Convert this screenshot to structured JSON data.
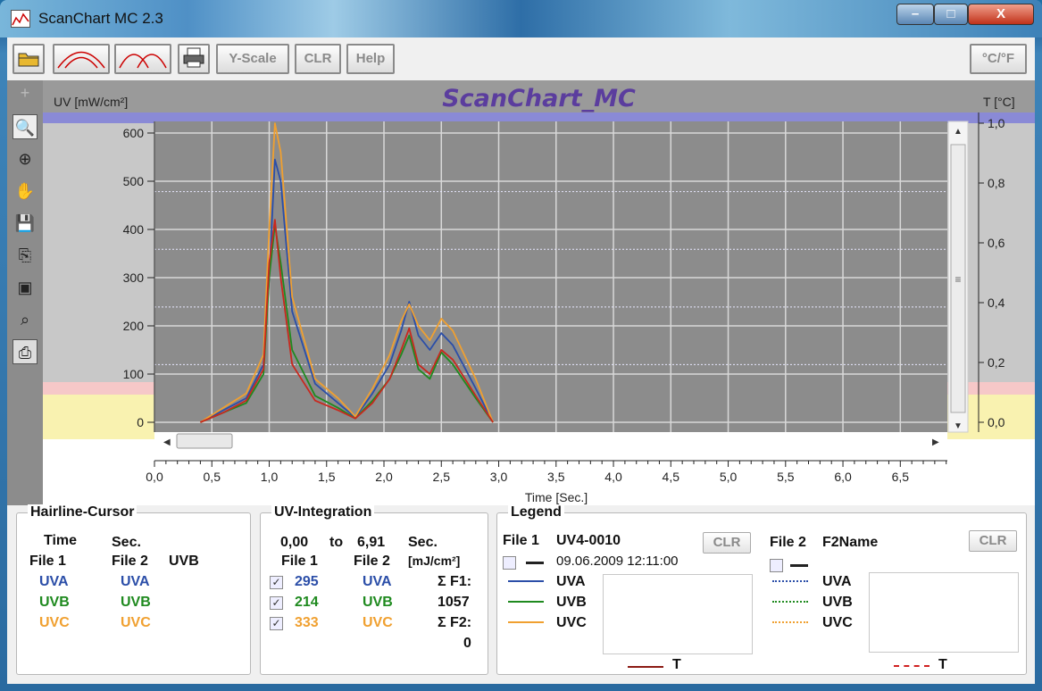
{
  "window": {
    "title": "ScanChart MC 2.3",
    "min": "–",
    "max": "□",
    "close": "X"
  },
  "toolbar": {
    "ylscale": "Y-Scale",
    "clr": "CLR",
    "help": "Help",
    "unit": "°C/°F"
  },
  "chart": {
    "title": "ScanChart_MC",
    "ylabel_left": "UV [mW/cm²]",
    "ylabel_right": "T [°C]",
    "xlabel": "Time [Sec.]",
    "ticks_left": [
      "0",
      "100",
      "200",
      "300",
      "400",
      "500",
      "600"
    ],
    "ticks_right": [
      "0,0",
      "0,2",
      "0,4",
      "0,6",
      "0,8",
      "1,0"
    ],
    "ticks_x": [
      "0,0",
      "0,5",
      "1,0",
      "1,5",
      "2,0",
      "2,5",
      "3,0",
      "3,5",
      "4,0",
      "4,5",
      "5,0",
      "5,5",
      "6,0",
      "6,5"
    ]
  },
  "chart_data": {
    "type": "line",
    "xlabel": "Time [Sec.]",
    "ylabel": "UV [mW/cm²]",
    "ylim": [
      0,
      650
    ],
    "xlim": [
      0,
      6.91
    ],
    "series": [
      {
        "name": "UVA",
        "color": "#2b4ea8",
        "x": [
          0.4,
          0.6,
          0.8,
          0.95,
          1.0,
          1.05,
          1.1,
          1.2,
          1.4,
          1.6,
          1.75,
          1.9,
          2.05,
          2.15,
          2.22,
          2.3,
          2.4,
          2.5,
          2.6,
          2.8,
          2.95
        ],
        "y": [
          0,
          25,
          50,
          120,
          300,
          545,
          500,
          230,
          80,
          40,
          10,
          60,
          120,
          190,
          250,
          180,
          150,
          185,
          160,
          70,
          0
        ]
      },
      {
        "name": "UVB",
        "color": "#1f8a1f",
        "x": [
          0.4,
          0.6,
          0.8,
          0.95,
          1.0,
          1.05,
          1.1,
          1.2,
          1.4,
          1.6,
          1.75,
          1.9,
          2.05,
          2.15,
          2.22,
          2.3,
          2.4,
          2.5,
          2.6,
          2.8,
          2.95
        ],
        "y": [
          0,
          20,
          40,
          100,
          300,
          410,
          330,
          150,
          55,
          30,
          8,
          45,
          90,
          140,
          180,
          110,
          90,
          145,
          120,
          50,
          0
        ]
      },
      {
        "name": "UVC",
        "color": "#f0a030",
        "x": [
          0.4,
          0.6,
          0.8,
          0.95,
          1.0,
          1.05,
          1.1,
          1.2,
          1.4,
          1.6,
          1.75,
          1.9,
          2.05,
          2.15,
          2.22,
          2.3,
          2.4,
          2.5,
          2.6,
          2.8,
          2.95
        ],
        "y": [
          0,
          30,
          60,
          140,
          400,
          620,
          560,
          260,
          90,
          50,
          12,
          70,
          140,
          210,
          245,
          200,
          170,
          215,
          190,
          90,
          0
        ]
      },
      {
        "name": "T",
        "color": "#c8281e",
        "x": [
          0.4,
          0.6,
          0.8,
          0.95,
          1.0,
          1.05,
          1.1,
          1.2,
          1.4,
          1.6,
          1.75,
          1.9,
          2.05,
          2.15,
          2.22,
          2.3,
          2.4,
          2.5,
          2.6,
          2.8,
          2.95
        ],
        "y": [
          0,
          20,
          45,
          110,
          330,
          420,
          300,
          120,
          45,
          25,
          8,
          40,
          90,
          150,
          195,
          120,
          100,
          150,
          130,
          55,
          0
        ]
      }
    ]
  },
  "hairline": {
    "title": "Hairline-Cursor",
    "time": "Time",
    "sec": "Sec.",
    "file1": "File 1",
    "file2": "File 2",
    "uvb_hdr": "UVB",
    "uva": "UVA",
    "uvb": "UVB",
    "uvc": "UVC"
  },
  "integration": {
    "title": "UV-Integration",
    "from": "0,00",
    "to": "to",
    "to_val": "6,91",
    "sec": "Sec.",
    "file1": "File 1",
    "file2": "File 2",
    "unit": "[mJ/cm²]",
    "uva_val": "295",
    "uvb_val": "214",
    "uvc_val": "333",
    "uva": "UVA",
    "uvb": "UVB",
    "uvc": "UVC",
    "sf1": "Σ F1:",
    "sf1_val": "1057",
    "sf2": "Σ F2:",
    "sf2_val": "0"
  },
  "legend": {
    "title": "Legend",
    "file1": "File 1",
    "file1_name": "UV4-0010",
    "file1_date": "09.06.2009 12:11:00",
    "file2": "File 2",
    "file2_name": "F2Name",
    "clr": "CLR",
    "uva": "UVA",
    "uvb": "UVB",
    "uvc": "UVC",
    "t": "T"
  }
}
